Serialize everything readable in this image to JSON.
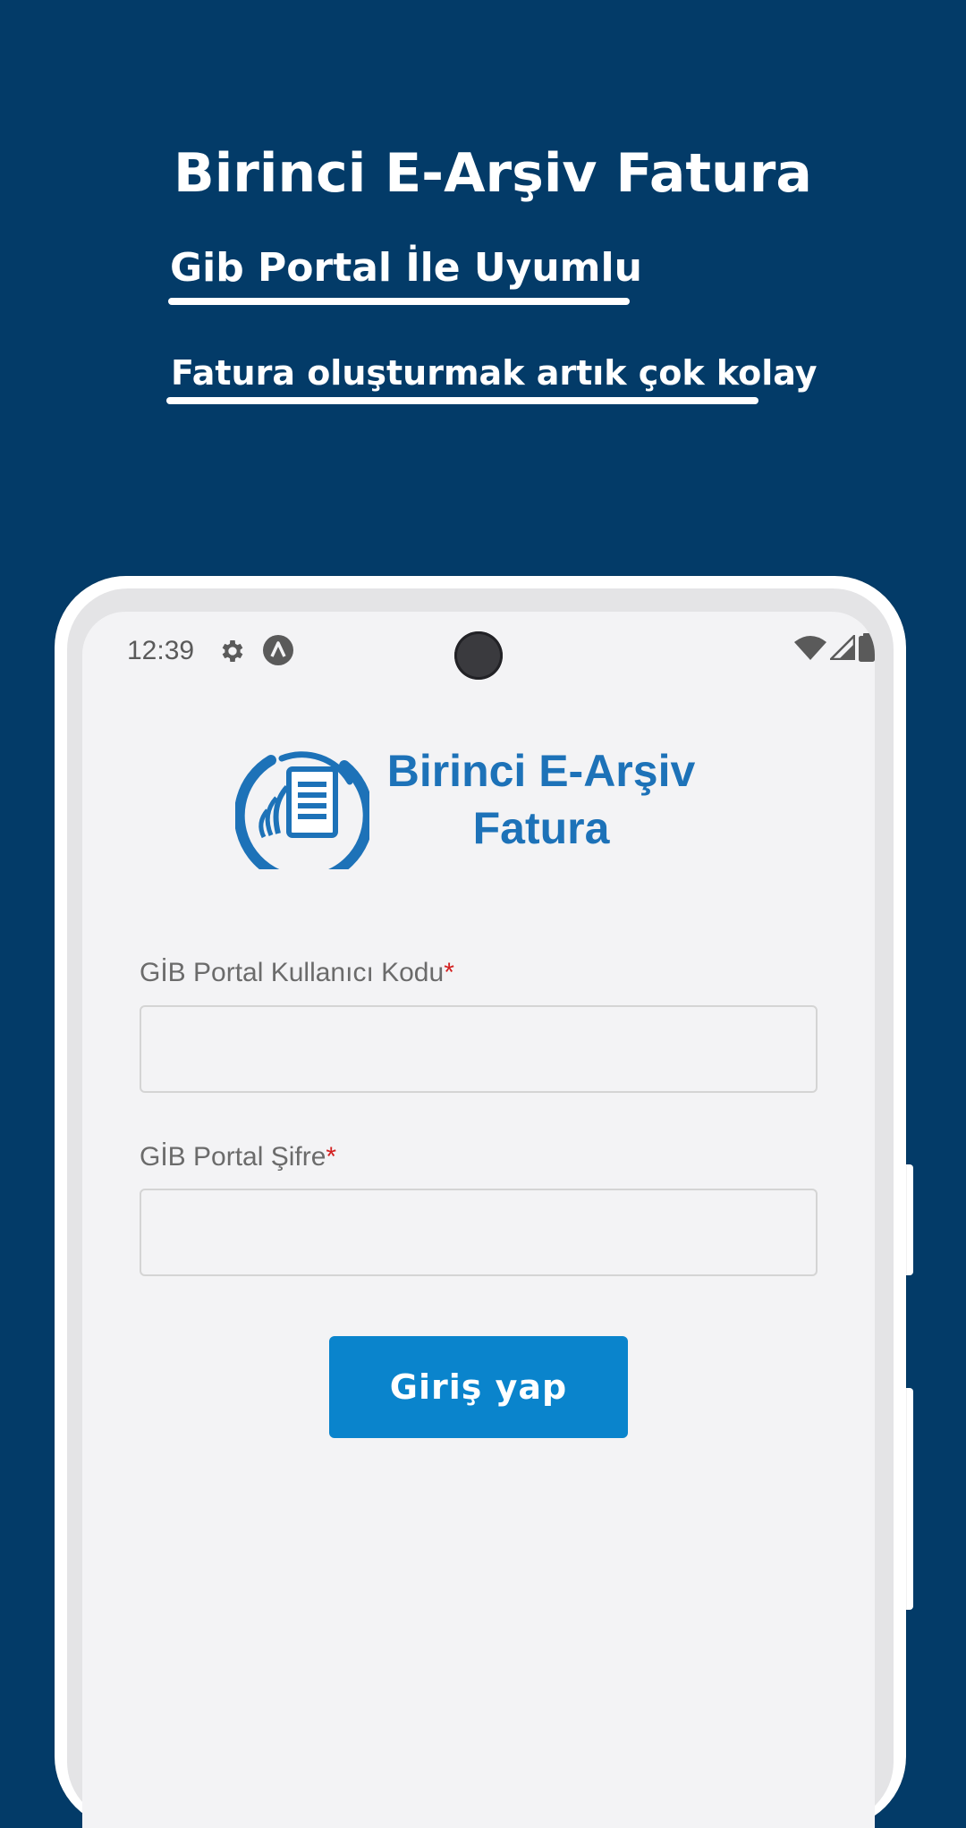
{
  "promo": {
    "title": "Birinci E-Arşiv Fatura",
    "subtitle1": "Gib Portal İle Uyumlu",
    "subtitle2": "Fatura oluşturmak artık çok kolay"
  },
  "status_bar": {
    "time": "12:39",
    "icons": [
      "gear-icon",
      "a-badge-icon",
      "wifi-icon",
      "signal-icon",
      "battery-icon"
    ]
  },
  "logo": {
    "line1": "Birinci E-Arşiv",
    "line2": "Fatura"
  },
  "form": {
    "username_label": "GİB Portal Kullanıcı Kodu",
    "password_label": "GİB Portal Şifre",
    "required_mark": "*",
    "username_value": "",
    "password_value": "",
    "login_label": "Giriş yap"
  },
  "colors": {
    "background": "#033b68",
    "primary_button": "#0a84cc",
    "logo_blue": "#1d72b8",
    "required": "#d32020"
  }
}
